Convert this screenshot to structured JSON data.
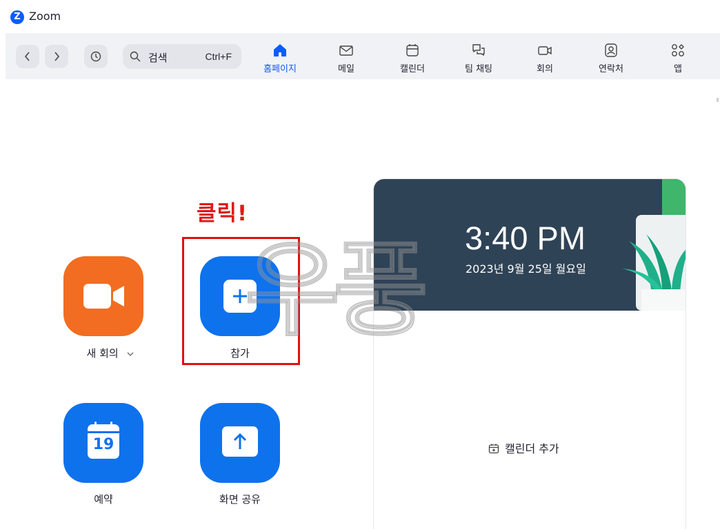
{
  "window": {
    "title": "Zoom",
    "logo_letter": "Z"
  },
  "toolbar": {
    "search_label": "검색",
    "search_shortcut": "Ctrl+F",
    "tabs": [
      {
        "label": "홈페이지",
        "icon": "home-icon",
        "active": true
      },
      {
        "label": "메일",
        "icon": "mail-icon"
      },
      {
        "label": "캘린더",
        "icon": "calendar-icon"
      },
      {
        "label": "팀 채팅",
        "icon": "chat-icon"
      },
      {
        "label": "회의",
        "icon": "video-icon"
      },
      {
        "label": "연락처",
        "icon": "contacts-icon"
      },
      {
        "label": "앱",
        "icon": "apps-icon"
      }
    ]
  },
  "actions": {
    "new_meeting": {
      "label": "새 회의",
      "color": "#f26d21"
    },
    "join": {
      "label": "참가",
      "color": "#0e72ed"
    },
    "schedule": {
      "label": "예약",
      "calendar_day": "19",
      "color": "#0e72ed"
    },
    "share_screen": {
      "label": "화면 공유",
      "color": "#0e72ed"
    }
  },
  "annotation": {
    "text": "클릭!",
    "color": "#e01010"
  },
  "calendar": {
    "time": "3:40 PM",
    "date": "2023년 9월 25일 월요일",
    "add_calendar": "캘린더 추가"
  },
  "watermark": {
    "text": "우풍"
  },
  "colors": {
    "accent": "#0b5cff",
    "toolbar_bg": "#f1f2f5"
  }
}
